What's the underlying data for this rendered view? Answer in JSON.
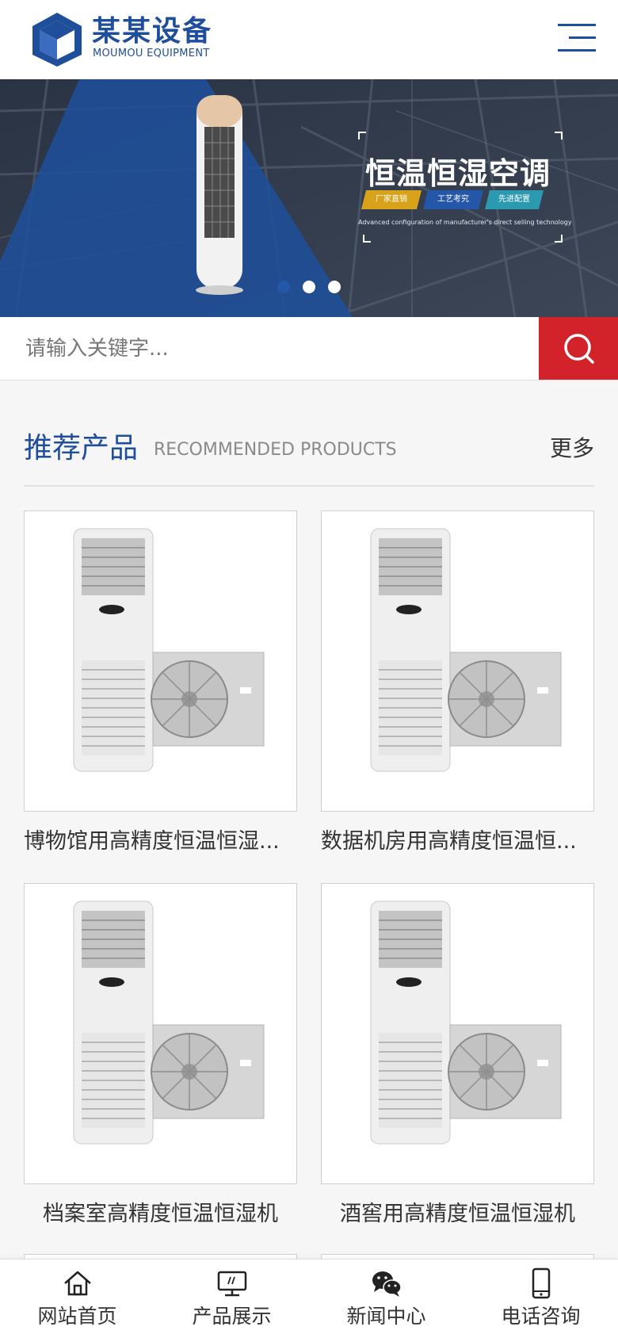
{
  "header": {
    "brand_cn": "某某设备",
    "brand_en": "MOUMOU EQUIPMENT",
    "brand_color": "#1f4e9a"
  },
  "banner": {
    "title": "恒温恒湿空调",
    "tags": [
      "厂家直销",
      "工艺考究",
      "先进配置"
    ],
    "tag_colors": [
      "#d9a21b",
      "#2457a8",
      "#2b9ab0"
    ],
    "subtitle": "Advanced configuration of manufacturer's direct selling technology",
    "slide_count": 3,
    "active_slide": 1
  },
  "search": {
    "placeholder": "请输入关键字...",
    "button_icon": "search-icon",
    "button_color": "#d2232a"
  },
  "section": {
    "title_cn": "推荐产品",
    "title_en": "RECOMMENDED PRODUCTS",
    "more": "更多"
  },
  "products": [
    {
      "name": "博物馆用高精度恒温恒湿..."
    },
    {
      "name": "数据机房用高精度恒温恒..."
    },
    {
      "name": "档案室高精度恒温恒湿机"
    },
    {
      "name": "酒窖用高精度恒温恒湿机"
    }
  ],
  "bottom_nav": [
    {
      "label": "网站首页",
      "icon": "home-icon"
    },
    {
      "label": "产品展示",
      "icon": "monitor-icon"
    },
    {
      "label": "新闻中心",
      "icon": "wechat-icon"
    },
    {
      "label": "电话咨询",
      "icon": "phone-icon"
    }
  ]
}
